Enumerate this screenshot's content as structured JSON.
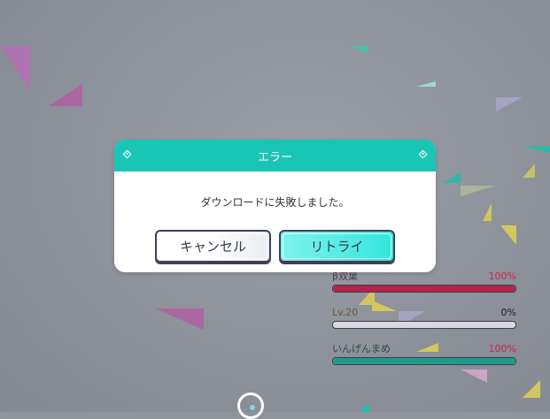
{
  "dialog": {
    "title": "エラー",
    "message": "ダウンロードに失敗しました。",
    "cancel_label": "キャンセル",
    "retry_label": "リトライ"
  },
  "status": [
    {
      "name": "β双葉",
      "percent_text": "100%",
      "fraction": 1.0,
      "color": "#b5234a"
    },
    {
      "name": "Lv.20",
      "percent_text": "0%",
      "fraction": 0.0,
      "color": "#2a2b3a"
    },
    {
      "name": "いんげんまめ",
      "percent_text": "100%",
      "fraction": 1.0,
      "color": "#1a9c8c"
    }
  ],
  "colors": {
    "accent": "#19c6b6",
    "retry_button": "#33e6db",
    "background": "#8f939a"
  }
}
